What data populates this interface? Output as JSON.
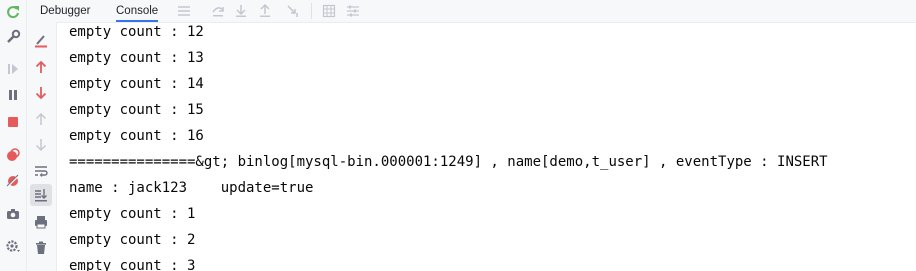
{
  "tabs": [
    {
      "label": "Debugger"
    },
    {
      "label": "Console"
    }
  ],
  "toolbar_icons": [
    "menu-icon",
    "step-over-icon",
    "step-into-icon",
    "step-out-icon",
    "run-to-cursor-icon",
    "table-icon",
    "settings-lines-icon"
  ],
  "left_rail_icons": [
    "rerun-icon",
    "wrench-icon",
    "resume-disabled-icon",
    "pause-icon",
    "stop-icon",
    "breakpoints-icon",
    "mute-breakpoints-icon",
    "camera-icon",
    "gear-icon"
  ],
  "console_rail_icons": [
    "clear-icon",
    "up-arrow-icon",
    "down-arrow-icon",
    "up-disabled-icon",
    "down-disabled-icon",
    "soft-wrap-icon",
    "scroll-to-end-icon",
    "print-icon",
    "trash-icon"
  ],
  "console": {
    "lines": [
      "empty count : 12",
      "empty count : 13",
      "empty count : 14",
      "empty count : 15",
      "empty count : 16",
      "===============&gt; binlog[mysql-bin.000001:1249] , name[demo,t_user] , eventType : INSERT",
      "name : jack123    update=true",
      "empty count : 1",
      "empty count : 2",
      "empty count : 3"
    ]
  },
  "colors": {
    "accent": "#3574f0",
    "red": "#e55b5b",
    "green": "#5fb85f",
    "gray_icon": "#6c707e",
    "disabled_icon": "#c4c7cf"
  }
}
